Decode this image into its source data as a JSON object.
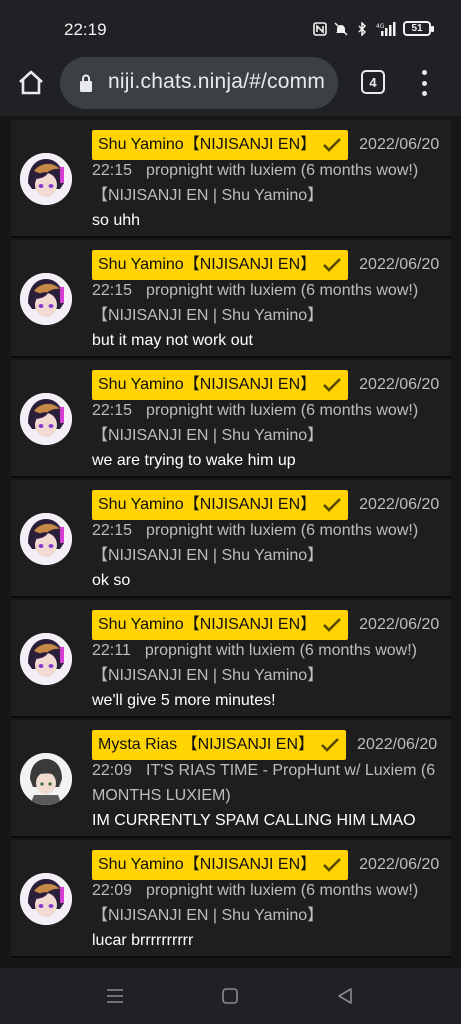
{
  "status_bar": {
    "time": "22:19",
    "battery": "51",
    "icons": [
      "nfc-icon",
      "mute-icon",
      "bluetooth-icon",
      "signal-4g-icon"
    ]
  },
  "browser": {
    "url": "niji.chats.ninja/#/comm",
    "tab_count": "4"
  },
  "messages": [
    {
      "name": "Shu Yamino【NIJISANJI EN】",
      "date": "2022/06/20",
      "time": "22:15",
      "stream": "propnight with luxiem (6 months wow!)【NIJISANJI EN | Shu Yamino】",
      "text": "so uhh",
      "avatar": "shu"
    },
    {
      "name": "Shu Yamino【NIJISANJI EN】",
      "date": "2022/06/20",
      "time": "22:15",
      "stream": "propnight with luxiem (6 months wow!)【NIJISANJI EN | Shu Yamino】",
      "text": "but it may not work out",
      "avatar": "shu"
    },
    {
      "name": "Shu Yamino【NIJISANJI EN】",
      "date": "2022/06/20",
      "time": "22:15",
      "stream": "propnight with luxiem (6 months wow!)【NIJISANJI EN | Shu Yamino】",
      "text": "we are trying to wake him up",
      "avatar": "shu"
    },
    {
      "name": "Shu Yamino【NIJISANJI EN】",
      "date": "2022/06/20",
      "time": "22:15",
      "stream": "propnight with luxiem (6 months wow!)【NIJISANJI EN | Shu Yamino】",
      "text": "ok so",
      "avatar": "shu"
    },
    {
      "name": "Shu Yamino【NIJISANJI EN】",
      "date": "2022/06/20",
      "time": "22:11",
      "stream": "propnight with luxiem (6 months wow!)【NIJISANJI EN | Shu Yamino】",
      "text": "we'll give 5 more minutes!",
      "avatar": "shu"
    },
    {
      "name": "Mysta Rias 【NIJISANJI EN】",
      "date": "2022/06/20",
      "time": "22:09",
      "stream": "IT'S RIAS TIME - PropHunt w/ Luxiem (6 MONTHS LUXIEM)",
      "text": "IM CURRENTLY SPAM CALLING HIM LMAO",
      "avatar": "mysta"
    },
    {
      "name": "Shu Yamino【NIJISANJI EN】",
      "date": "2022/06/20",
      "time": "22:09",
      "stream": "propnight with luxiem (6 months wow!)【NIJISANJI EN | Shu Yamino】",
      "text": "lucar brrrrrrrrrr",
      "avatar": "shu"
    }
  ],
  "colors": {
    "badge": "#ffd400",
    "card": "#1e1e1e",
    "background": "#161616",
    "chrome": "#202124"
  }
}
